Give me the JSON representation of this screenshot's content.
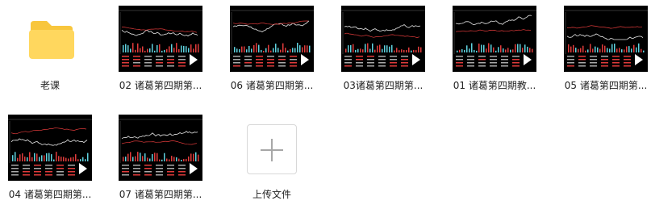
{
  "items": [
    {
      "type": "folder",
      "label": "老课"
    },
    {
      "type": "video",
      "label": "02 诸葛第四期第..."
    },
    {
      "type": "video",
      "label": "06 诸葛第四期第..."
    },
    {
      "type": "video",
      "label": "03诸葛第四期第..."
    },
    {
      "type": "video",
      "label": "01 诸葛第四期教..."
    },
    {
      "type": "video",
      "label": "05 诸葛第四期第..."
    },
    {
      "type": "video",
      "label": "04 诸葛第四期第..."
    },
    {
      "type": "video",
      "label": "07 诸葛第四期第..."
    }
  ],
  "upload": {
    "label": "上传文件",
    "icon": "plus-icon"
  },
  "colors": {
    "folder": "#FFD75E",
    "folder_tab": "#F8C63D",
    "thumbnail_bg": "#000000",
    "chart_red": "#e23b3b",
    "chart_cyan": "#5fd3e0"
  }
}
